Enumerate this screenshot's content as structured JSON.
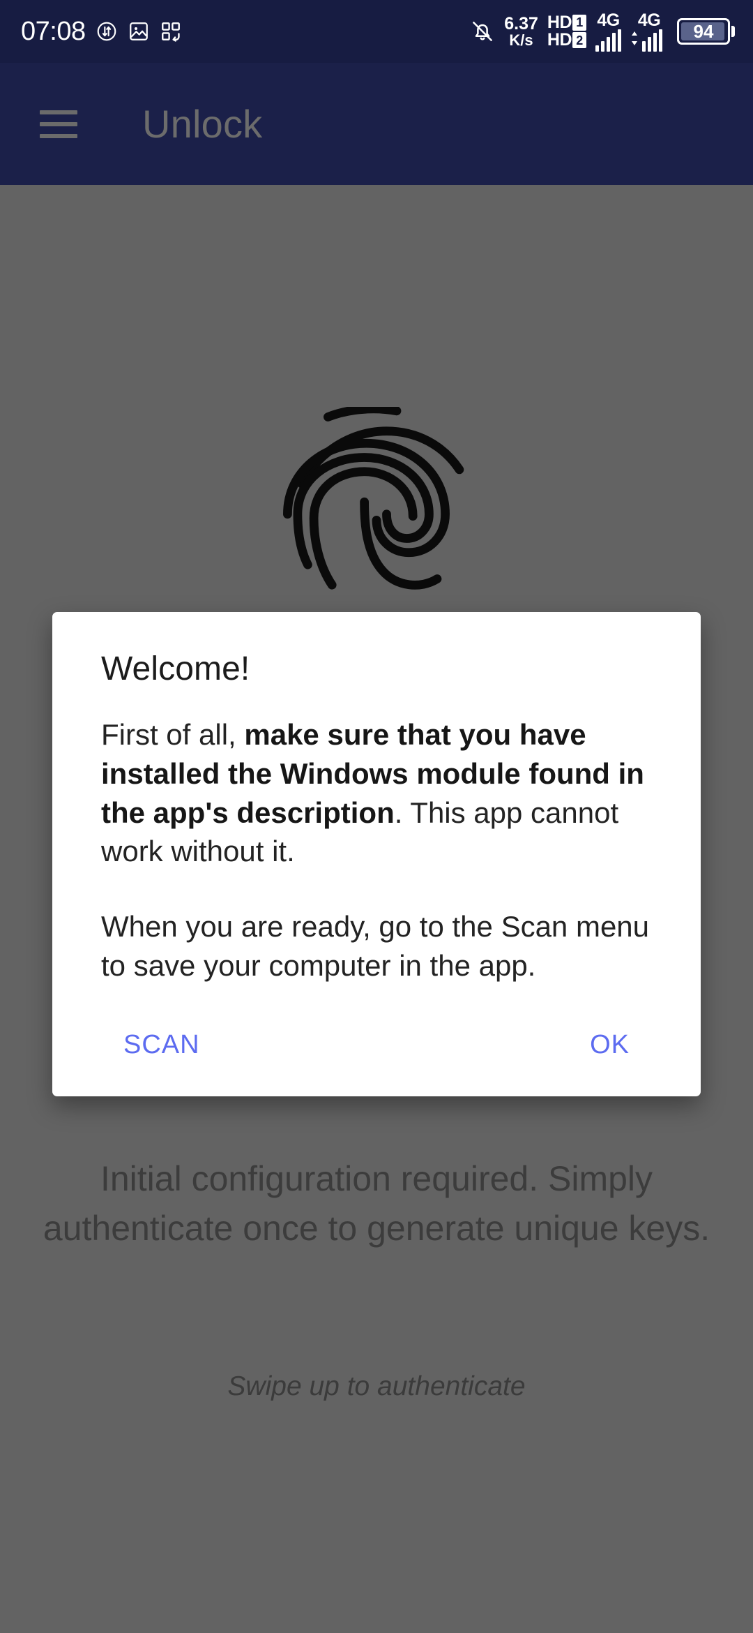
{
  "status_bar": {
    "time": "07:08",
    "icons_left": [
      "data-transfer-icon",
      "gallery-image-icon",
      "app-grid-refresh-icon"
    ],
    "network_speed": {
      "value": "6.37",
      "unit": "K/s"
    },
    "hd_labels": {
      "sim1": "HD",
      "sim1_slot": "1",
      "sim2": "HD",
      "sim2_slot": "2"
    },
    "signal_1": {
      "generation": "4G",
      "bars": 5
    },
    "signal_2": {
      "generation": "4G",
      "bars": 5
    },
    "battery": {
      "percent": "94"
    },
    "mute_icon": "notifications-off-icon",
    "background_color": "#171C42"
  },
  "app_bar": {
    "menu_icon": "hamburger-menu-icon",
    "title": "Unlock",
    "background_color": "#1B2049",
    "title_color": "#6C6C6C"
  },
  "main": {
    "fingerprint_icon": "fingerprint-icon",
    "hint_text": "Initial configuration required. Simply authenticate once to generate unique keys.",
    "swipe_text": "Swipe up to authenticate",
    "scrim_color": "#636363"
  },
  "dialog": {
    "title": "Welcome!",
    "body": {
      "para1_prefix": "First of all, ",
      "para1_bold": "make sure that you have installed the Windows module found in the app's description",
      "para1_suffix": ". This app cannot work without it.",
      "para2": "When you are ready, go to the Scan menu to save your computer in the app."
    },
    "buttons": {
      "scan_label": "SCAN",
      "ok_label": "OK"
    },
    "accent_color": "#5C6BF0",
    "background_color": "#FFFFFF"
  }
}
